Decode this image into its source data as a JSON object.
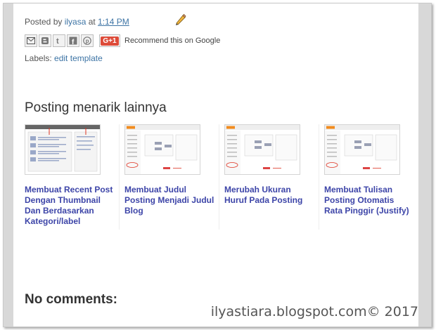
{
  "post_footer": {
    "posted_by_label": "Posted by",
    "author": "ilyasa",
    "at_label": "at",
    "time": "1:14 PM"
  },
  "share": {
    "buttons": [
      "email-icon",
      "blogger-icon",
      "twitter-icon",
      "facebook-icon",
      "pinterest-icon"
    ],
    "gplus_label": "G+1",
    "recommend_text": "Recommend this on Google"
  },
  "labels": {
    "label": "Labels:",
    "link": "edit template"
  },
  "related": {
    "heading": "Posting menarik lainnya",
    "items": [
      {
        "title": "Membuat Recent Post Dengan Thumbnail Dan Berdasarkan Kategori/label"
      },
      {
        "title": "Membuat Judul Posting Menjadi Judul Blog"
      },
      {
        "title": "Merubah Ukuran Huruf Pada Posting"
      },
      {
        "title": "Membuat Tulisan Posting Otomatis Rata Pinggir (Justify)"
      }
    ]
  },
  "comments": {
    "heading": "No comments:"
  },
  "watermark": "ilyastiara.blogspot.com© 2017",
  "colors": {
    "link": "#3d74a5",
    "related_title": "#3d45a8",
    "gutter": "#d8d8d8"
  }
}
